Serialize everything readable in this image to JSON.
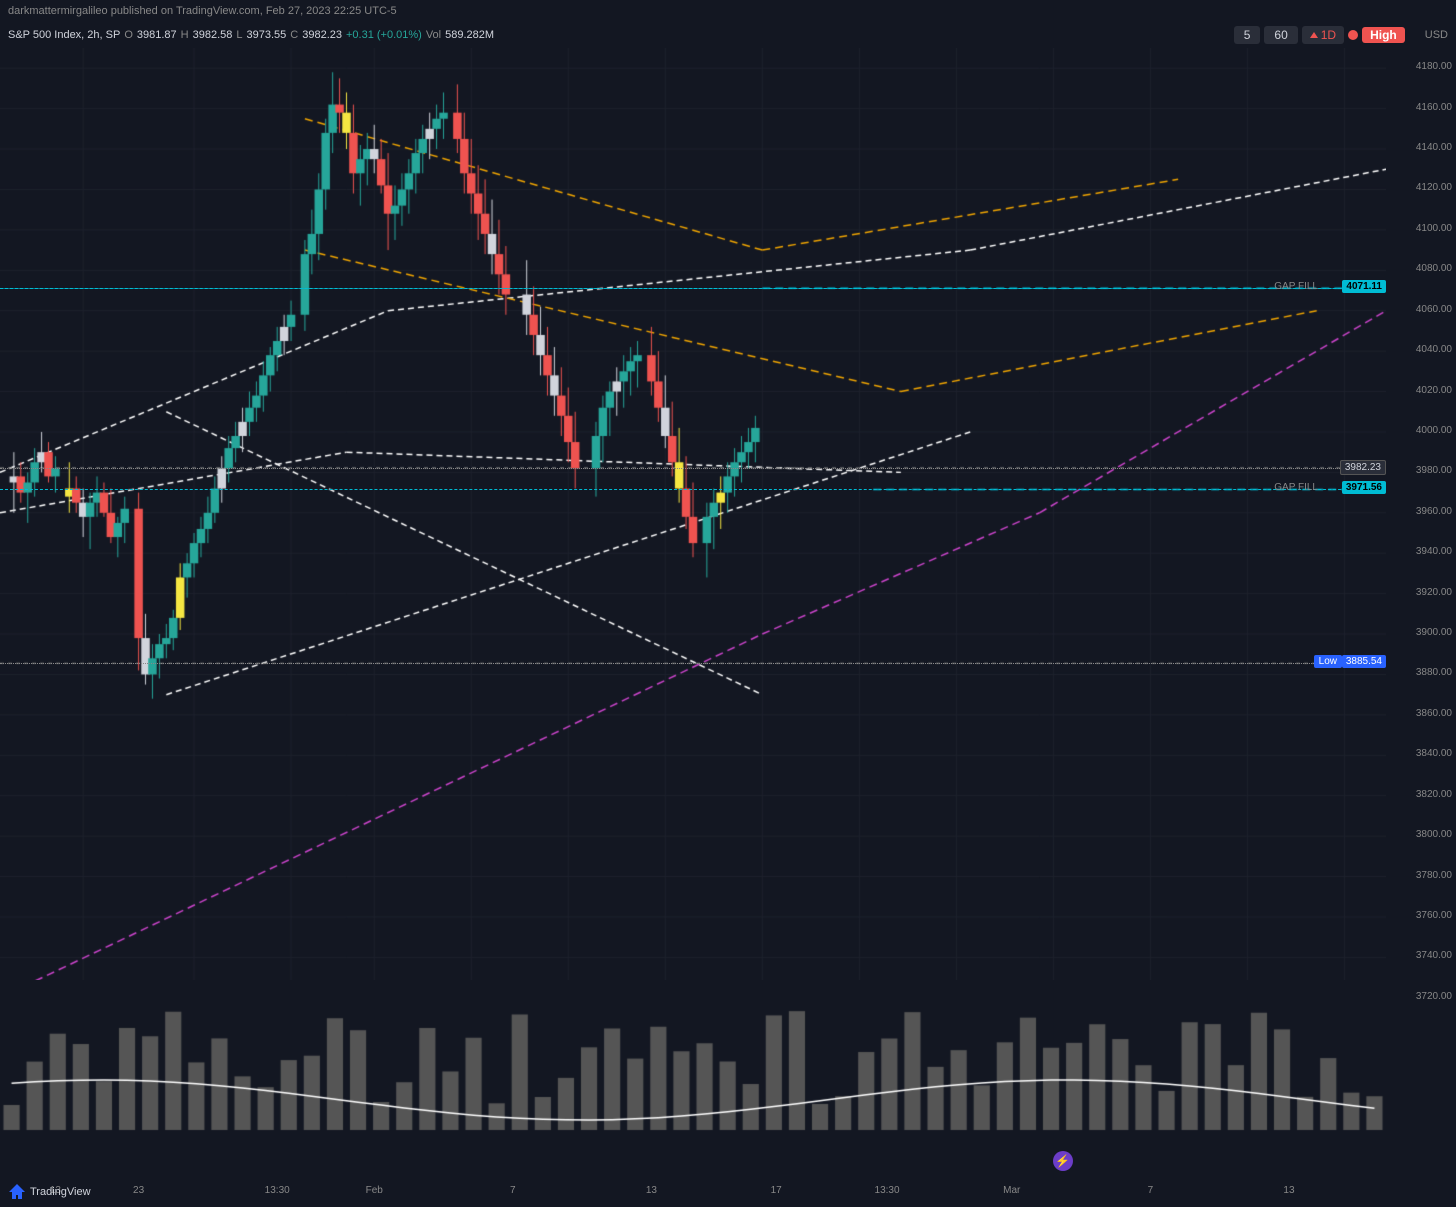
{
  "publisher": "darkmattermirgalileo published on TradingView.com, Feb 27, 2023 22:25 UTC-5",
  "symbol": {
    "name": "S&P 500 Index, 2h, SP",
    "open_label": "O",
    "open": "3981.87",
    "high_label": "H",
    "high": "3982.58",
    "low_label": "L",
    "low": "3973.55",
    "close_label": "C",
    "close": "3982.23",
    "change": "+0.31 (+0.01%)",
    "volume_label": "Vol",
    "volume": "589.282M"
  },
  "timeframes": {
    "tf5": "5",
    "tf60": "60",
    "tf1d": "1D",
    "alert": "High"
  },
  "currency": "USD",
  "price_levels": {
    "gap_fill_upper": "4071.11",
    "gap_fill_lower": "3971.56",
    "current": "3982.23",
    "low_level": "3885.54",
    "prices": [
      "4180.00",
      "4160.00",
      "4140.00",
      "4120.00",
      "4100.00",
      "4080.00",
      "4060.00",
      "4040.00",
      "4020.00",
      "4000.00",
      "3980.00",
      "3960.00",
      "3940.00",
      "3920.00",
      "3900.00",
      "3880.00",
      "3860.00",
      "3840.00",
      "3820.00",
      "3800.00",
      "3780.00",
      "3760.00",
      "3740.00",
      "3720.00"
    ]
  },
  "time_labels": [
    "13",
    "23",
    "13:30",
    "Feb",
    "7",
    "13",
    "17",
    "13:30",
    "Mar",
    "7",
    "13"
  ],
  "annotations": {
    "gap_fill_upper_text": "GAP FILL",
    "gap_fill_lower_text": "GAP FILL",
    "low_text": "Low",
    "high_text": "High"
  }
}
